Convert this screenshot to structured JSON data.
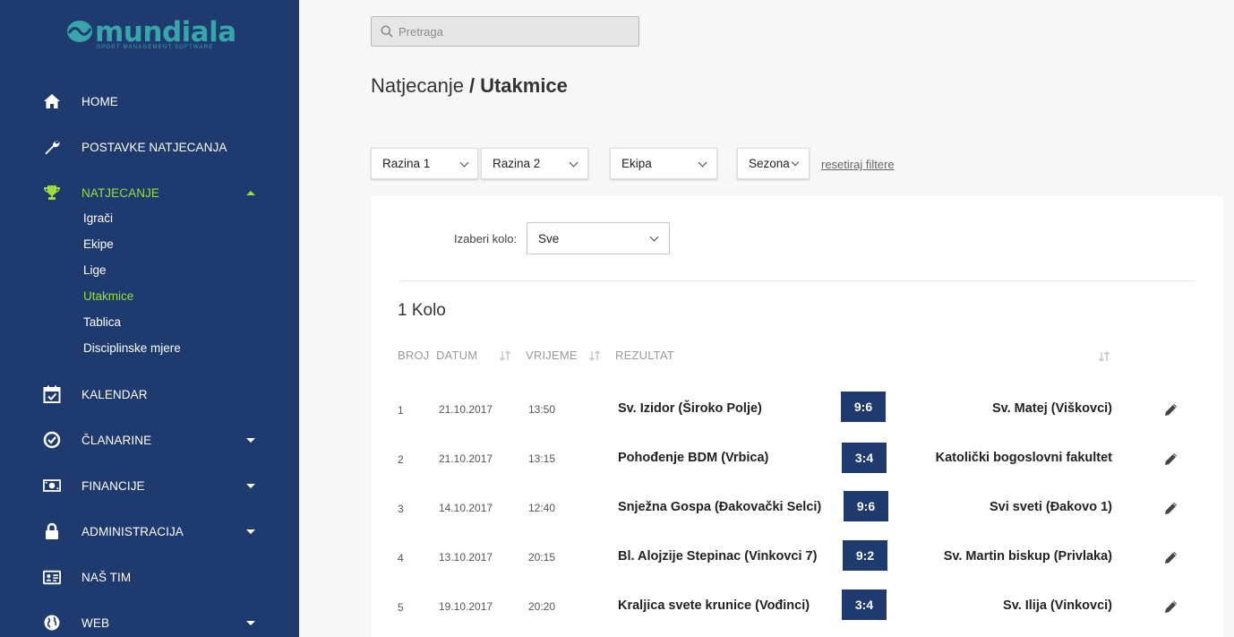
{
  "brand": {
    "name": "mundiala",
    "tagline": "SPORT MANAGEMENT SOFTWARE",
    "color": "#37a5a9"
  },
  "colors": {
    "sidebar": "#1e3a6e",
    "active": "#9fdc3c",
    "score_bg": "#1e3a6e"
  },
  "sidebar": {
    "items": [
      {
        "label": "HOME",
        "icon": "home-icon"
      },
      {
        "label": "POSTAVKE NATJECANJA",
        "icon": "wrench-icon"
      },
      {
        "label": "NATJECANJE",
        "icon": "trophy-icon",
        "active": true,
        "expanded": true
      },
      {
        "label": "KALENDAR",
        "icon": "calendar-check-icon"
      },
      {
        "label": "ČLANARINE",
        "icon": "check-circle-icon",
        "has_submenu": true
      },
      {
        "label": "FINANCIJE",
        "icon": "money-icon",
        "has_submenu": true
      },
      {
        "label": "ADMINISTRACIJA",
        "icon": "lock-icon",
        "has_submenu": true
      },
      {
        "label": "NAŠ TIM",
        "icon": "id-card-icon"
      },
      {
        "label": "WEB",
        "icon": "globe-icon",
        "has_submenu": true
      }
    ],
    "subitems": [
      {
        "label": "Igrači"
      },
      {
        "label": "Ekipe"
      },
      {
        "label": "Lige"
      },
      {
        "label": "Utakmice",
        "active": true
      },
      {
        "label": "Tablica"
      },
      {
        "label": "Disciplinske mjere"
      }
    ]
  },
  "search": {
    "placeholder": "Pretraga"
  },
  "breadcrumb": {
    "parent": "Natjecanje",
    "separator": "/",
    "current": "Utakmice"
  },
  "filters": {
    "level1": "Razina 1",
    "level2": "Razina 2",
    "team": "Ekipa",
    "season": "Sezona",
    "reset": "resetiraj filtere"
  },
  "round_select": {
    "label": "Izaberi kolo:",
    "value": "Sve"
  },
  "round_title": "1 Kolo",
  "table": {
    "headers": {
      "number": "BROJ",
      "date": "DATUM",
      "time": "VRIJEME",
      "result": "REZULTAT"
    },
    "rows": [
      {
        "number": "1",
        "date": "21.10.2017",
        "time": "13:50",
        "home": "Sv. Izidor (Široko Polje)",
        "score": "9:6",
        "away": "Sv. Matej (Viškovci)"
      },
      {
        "number": "2",
        "date": "21.10.2017",
        "time": "13:15",
        "home": "Pohođenje BDM (Vrbica)",
        "score": "3:4",
        "away": "Katolički bogoslovni fakultet"
      },
      {
        "number": "3",
        "date": "14.10.2017",
        "time": "12:40",
        "home": "Snježna Gospa (Đakovački Selci)",
        "score": "9:6",
        "away": "Svi sveti (Đakovo 1)"
      },
      {
        "number": "4",
        "date": "13.10.2017",
        "time": "20:15",
        "home": "Bl. Alojzije Stepinac (Vinkovci 7)",
        "score": "9:2",
        "away": "Sv. Martin biskup (Privlaka)"
      },
      {
        "number": "5",
        "date": "19.10.2017",
        "time": "20:20",
        "home": "Kraljica svete krunice (Vođinci)",
        "score": "3:4",
        "away": "Sv. Ilija (Vinkovci)"
      }
    ]
  }
}
